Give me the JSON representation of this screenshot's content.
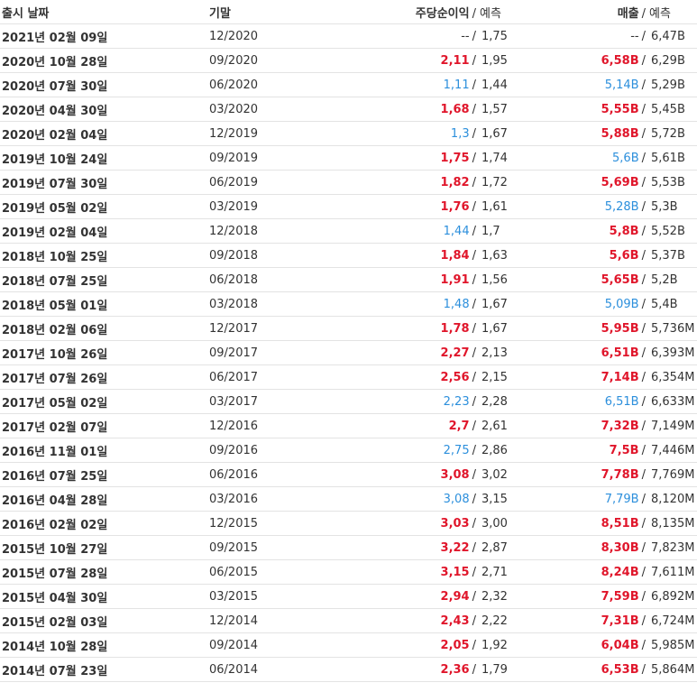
{
  "header": {
    "date": "출시 날짜",
    "period": "기말",
    "eps": "주당순이익",
    "forecast": "예측",
    "revenue": "매출",
    "slash": "/"
  },
  "colors": {
    "beat": "#e0162b",
    "miss": "#2c8fdc",
    "text": "#333333"
  },
  "rows": [
    {
      "date": "2021년 02월 09일",
      "period": "12/2020",
      "eps": "--",
      "eps_f": "1,75",
      "eps_s": "none",
      "rev": "--",
      "rev_f": "6,47B",
      "rev_s": "none"
    },
    {
      "date": "2020년 10월 28일",
      "period": "09/2020",
      "eps": "2,11",
      "eps_f": "1,95",
      "eps_s": "beat",
      "rev": "6,58B",
      "rev_f": "6,29B",
      "rev_s": "beat"
    },
    {
      "date": "2020년 07월 30일",
      "period": "06/2020",
      "eps": "1,11",
      "eps_f": "1,44",
      "eps_s": "miss",
      "rev": "5,14B",
      "rev_f": "5,29B",
      "rev_s": "miss"
    },
    {
      "date": "2020년 04월 30일",
      "period": "03/2020",
      "eps": "1,68",
      "eps_f": "1,57",
      "eps_s": "beat",
      "rev": "5,55B",
      "rev_f": "5,45B",
      "rev_s": "beat"
    },
    {
      "date": "2020년 02월 04일",
      "period": "12/2019",
      "eps": "1,3",
      "eps_f": "1,67",
      "eps_s": "miss",
      "rev": "5,88B",
      "rev_f": "5,72B",
      "rev_s": "beat"
    },
    {
      "date": "2019년 10월 24일",
      "period": "09/2019",
      "eps": "1,75",
      "eps_f": "1,74",
      "eps_s": "beat",
      "rev": "5,6B",
      "rev_f": "5,61B",
      "rev_s": "miss"
    },
    {
      "date": "2019년 07월 30일",
      "period": "06/2019",
      "eps": "1,82",
      "eps_f": "1,72",
      "eps_s": "beat",
      "rev": "5,69B",
      "rev_f": "5,53B",
      "rev_s": "beat"
    },
    {
      "date": "2019년 05월 02일",
      "period": "03/2019",
      "eps": "1,76",
      "eps_f": "1,61",
      "eps_s": "beat",
      "rev": "5,28B",
      "rev_f": "5,3B",
      "rev_s": "miss"
    },
    {
      "date": "2019년 02월 04일",
      "period": "12/2018",
      "eps": "1,44",
      "eps_f": "1,7",
      "eps_s": "miss",
      "rev": "5,8B",
      "rev_f": "5,52B",
      "rev_s": "beat"
    },
    {
      "date": "2018년 10월 25일",
      "period": "09/2018",
      "eps": "1,84",
      "eps_f": "1,63",
      "eps_s": "beat",
      "rev": "5,6B",
      "rev_f": "5,37B",
      "rev_s": "beat"
    },
    {
      "date": "2018년 07월 25일",
      "period": "06/2018",
      "eps": "1,91",
      "eps_f": "1,56",
      "eps_s": "beat",
      "rev": "5,65B",
      "rev_f": "5,2B",
      "rev_s": "beat"
    },
    {
      "date": "2018년 05월 01일",
      "period": "03/2018",
      "eps": "1,48",
      "eps_f": "1,67",
      "eps_s": "miss",
      "rev": "5,09B",
      "rev_f": "5,4B",
      "rev_s": "miss"
    },
    {
      "date": "2018년 02월 06일",
      "period": "12/2017",
      "eps": "1,78",
      "eps_f": "1,67",
      "eps_s": "beat",
      "rev": "5,95B",
      "rev_f": "5,736M",
      "rev_s": "beat"
    },
    {
      "date": "2017년 10월 26일",
      "period": "09/2017",
      "eps": "2,27",
      "eps_f": "2,13",
      "eps_s": "beat",
      "rev": "6,51B",
      "rev_f": "6,393M",
      "rev_s": "beat"
    },
    {
      "date": "2017년 07월 26일",
      "period": "06/2017",
      "eps": "2,56",
      "eps_f": "2,15",
      "eps_s": "beat",
      "rev": "7,14B",
      "rev_f": "6,354M",
      "rev_s": "beat"
    },
    {
      "date": "2017년 05월 02일",
      "period": "03/2017",
      "eps": "2,23",
      "eps_f": "2,28",
      "eps_s": "miss",
      "rev": "6,51B",
      "rev_f": "6,633M",
      "rev_s": "miss"
    },
    {
      "date": "2017년 02월 07일",
      "period": "12/2016",
      "eps": "2,7",
      "eps_f": "2,61",
      "eps_s": "beat",
      "rev": "7,32B",
      "rev_f": "7,149M",
      "rev_s": "beat"
    },
    {
      "date": "2016년 11월 01일",
      "period": "09/2016",
      "eps": "2,75",
      "eps_f": "2,86",
      "eps_s": "miss",
      "rev": "7,5B",
      "rev_f": "7,446M",
      "rev_s": "beat"
    },
    {
      "date": "2016년 07월 25일",
      "period": "06/2016",
      "eps": "3,08",
      "eps_f": "3,02",
      "eps_s": "beat",
      "rev": "7,78B",
      "rev_f": "7,769M",
      "rev_s": "beat"
    },
    {
      "date": "2016년 04월 28일",
      "period": "03/2016",
      "eps": "3,08",
      "eps_f": "3,15",
      "eps_s": "miss",
      "rev": "7,79B",
      "rev_f": "8,120M",
      "rev_s": "miss"
    },
    {
      "date": "2016년 02월 02일",
      "period": "12/2015",
      "eps": "3,03",
      "eps_f": "3,00",
      "eps_s": "beat",
      "rev": "8,51B",
      "rev_f": "8,135M",
      "rev_s": "beat"
    },
    {
      "date": "2015년 10월 27일",
      "period": "09/2015",
      "eps": "3,22",
      "eps_f": "2,87",
      "eps_s": "beat",
      "rev": "8,30B",
      "rev_f": "7,823M",
      "rev_s": "beat"
    },
    {
      "date": "2015년 07월 28일",
      "period": "06/2015",
      "eps": "3,15",
      "eps_f": "2,71",
      "eps_s": "beat",
      "rev": "8,24B",
      "rev_f": "7,611M",
      "rev_s": "beat"
    },
    {
      "date": "2015년 04월 30일",
      "period": "03/2015",
      "eps": "2,94",
      "eps_f": "2,32",
      "eps_s": "beat",
      "rev": "7,59B",
      "rev_f": "6,892M",
      "rev_s": "beat"
    },
    {
      "date": "2015년 02월 03일",
      "period": "12/2014",
      "eps": "2,43",
      "eps_f": "2,22",
      "eps_s": "beat",
      "rev": "7,31B",
      "rev_f": "6,724M",
      "rev_s": "beat"
    },
    {
      "date": "2014년 10월 28일",
      "period": "09/2014",
      "eps": "2,05",
      "eps_f": "1,92",
      "eps_s": "beat",
      "rev": "6,04B",
      "rev_f": "5,985M",
      "rev_s": "beat"
    },
    {
      "date": "2014년 07월 23일",
      "period": "06/2014",
      "eps": "2,36",
      "eps_f": "1,79",
      "eps_s": "beat",
      "rev": "6,53B",
      "rev_f": "5,864M",
      "rev_s": "beat"
    }
  ]
}
